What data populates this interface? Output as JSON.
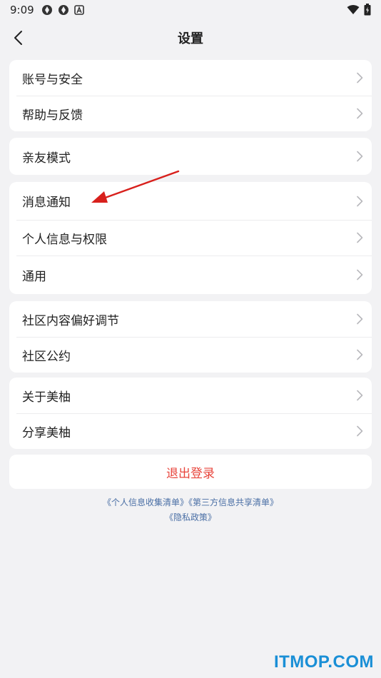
{
  "status_bar": {
    "time": "9:09"
  },
  "header": {
    "title": "设置"
  },
  "groups": [
    {
      "items": [
        {
          "label": "账号与安全"
        },
        {
          "label": "帮助与反馈"
        }
      ]
    },
    {
      "items": [
        {
          "label": "亲友模式"
        }
      ]
    },
    {
      "items": [
        {
          "label": "消息通知"
        },
        {
          "label": "个人信息与权限"
        },
        {
          "label": "通用"
        }
      ]
    },
    {
      "items": [
        {
          "label": "社区内容偏好调节"
        },
        {
          "label": "社区公约"
        }
      ]
    },
    {
      "items": [
        {
          "label": "关于美柚"
        },
        {
          "label": "分享美柚"
        }
      ]
    }
  ],
  "logout": {
    "label": "退出登录"
  },
  "links": {
    "personal_info_list": "《个人信息收集清单》",
    "third_party_list": "《第三方信息共享清单》",
    "privacy_policy": "《隐私政策》"
  },
  "watermark": {
    "text": "ITMOP.COM"
  },
  "colors": {
    "background": "#f2f2f4",
    "logout_red": "#e8453c",
    "link_blue": "#4a6fa5",
    "annotation_arrow": "#d8201c",
    "watermark_blue": "#1a8fd6",
    "chevron": "#b8b8bc"
  },
  "icons": {
    "back": "chevron-left-icon",
    "row_arrow": "chevron-right-icon",
    "wifi": "wifi-icon",
    "battery": "battery-icon"
  }
}
